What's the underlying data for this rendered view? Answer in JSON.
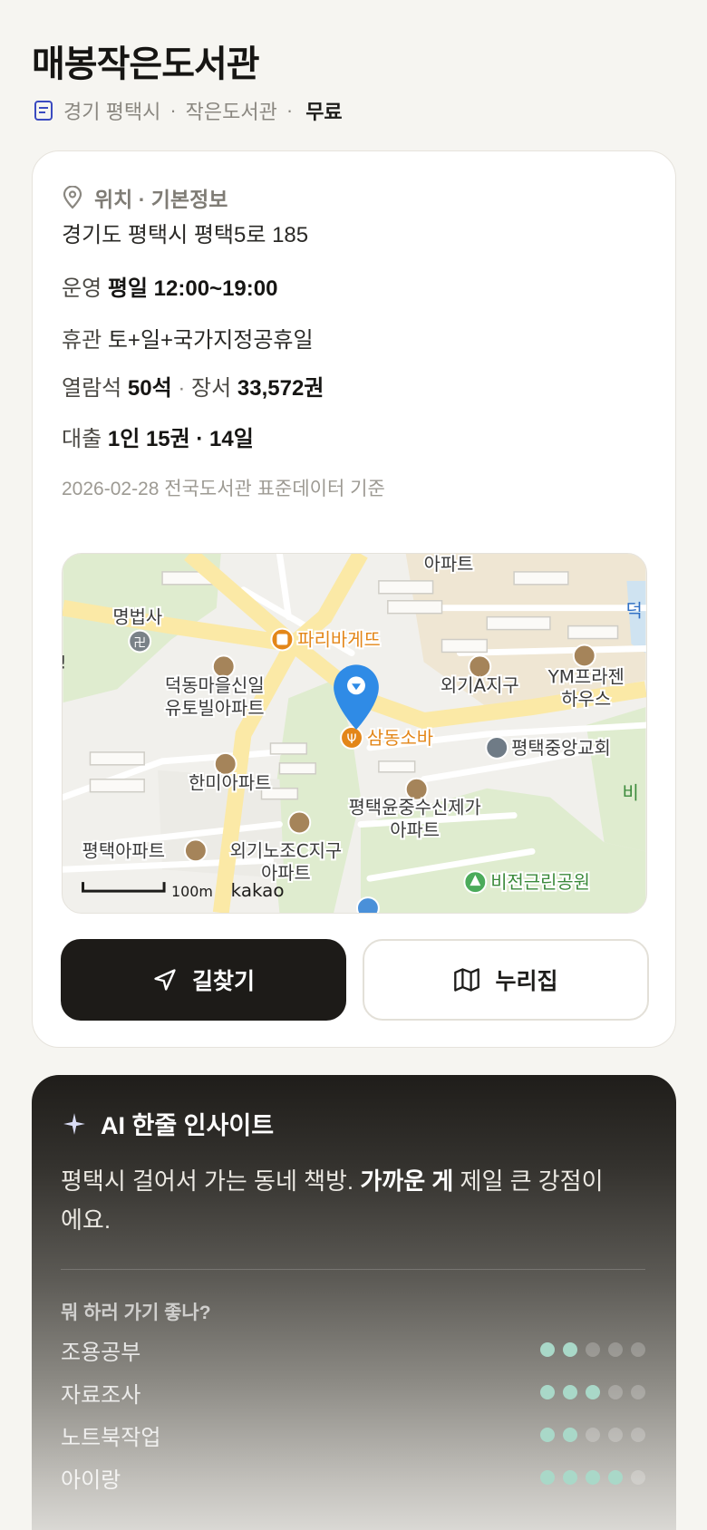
{
  "header": {
    "title": "매봉작은도서관",
    "region": "경기 평택시",
    "type": "작은도서관",
    "fee": "무료",
    "sep1": "·",
    "sep2": "·"
  },
  "info": {
    "section_label": "위치 · 기본정보",
    "address": "경기도 평택시 평택5로 185",
    "hours_label": "운영",
    "hours_value": "평일 12:00~19:00",
    "closed_label": "휴관",
    "closed_value": "토+일+국가지정공휴일",
    "seats_label": "열람석",
    "seats_value": "50석",
    "dot": "·",
    "books_label": "장서",
    "books_value": "33,572권",
    "loan_label": "대출",
    "loan_value": "1인 15권 · 14일",
    "basis": "2026-02-28 전국도서관 표준데이터 기준"
  },
  "map": {
    "labels": {
      "apt_top": "아파트",
      "temple": "명법사",
      "bakery": "파리바게뜨",
      "deok_right": "덕",
      "exclaim": "!",
      "deokdong_1": "덕동마을신일",
      "deokdong_2": "유토빌아파트",
      "oegi_a": "외기A지구",
      "ym_1": "YM프라젠",
      "ym_2": "하우스",
      "samdong": "삼동소바",
      "church": "평택중앙교회",
      "hanmi": "한미아파트",
      "yunjung_1": "평택윤중수신제가",
      "yunjung_2": "아파트",
      "bi_right": "비",
      "pyeongtaek_apt": "평택아파트",
      "oegi_c_1": "외기노조C지구",
      "oegi_c_2": "아파트",
      "park": "비전근린공원",
      "scale": "100m",
      "brand": "kakao"
    }
  },
  "actions": {
    "directions": "길찾기",
    "nurijip": "누리집"
  },
  "ai": {
    "title": "AI 한줄 인사이트",
    "text_a": "평택시 걸어서 가는 동네 책방. ",
    "text_b": "가까운 게",
    "text_c": " 제일 큰 강점이에요.",
    "question": "뭐 하러 가기 좋나?",
    "activities": [
      {
        "name": "조용공부",
        "score": 2
      },
      {
        "name": "자료조사",
        "score": 3
      },
      {
        "name": "노트북작업",
        "score": 2
      },
      {
        "name": "아이랑",
        "score": 4
      }
    ],
    "max_score": 5
  },
  "colors": {
    "accent_dot": "#a9d8c8",
    "pin": "#2f8be6",
    "poi_orange": "#e38618",
    "poi_brown": "#a5845a",
    "park_green": "#4bab5b"
  }
}
